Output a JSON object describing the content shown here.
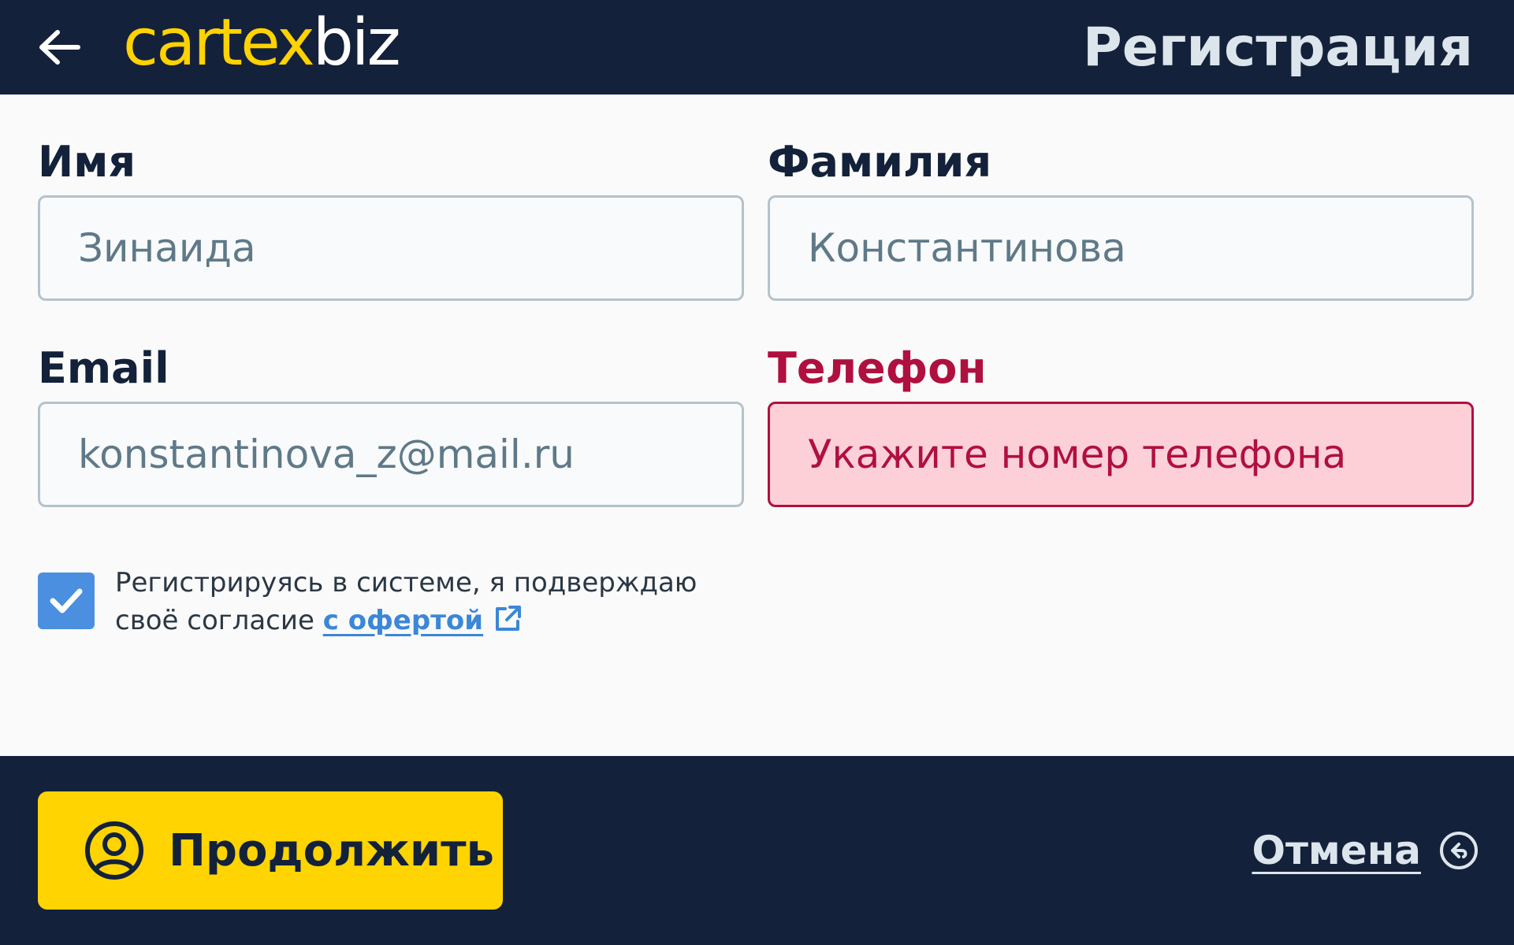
{
  "header": {
    "logo_part1": "cartex",
    "logo_part2": "biz",
    "title": "Регистрация",
    "back_icon": "arrow-left-icon"
  },
  "form": {
    "first_name": {
      "label": "Имя",
      "value": "Зинаида"
    },
    "last_name": {
      "label": "Фамилия",
      "value": "Константинова"
    },
    "email": {
      "label": "Email",
      "value": "konstantinova_z@mail.ru"
    },
    "phone": {
      "label": "Телефон",
      "value": "",
      "placeholder": "Укажите номер телефона",
      "state": "error"
    }
  },
  "consent": {
    "checked": true,
    "text_line1": "Регистрируясь в системе, я подверждаю",
    "text_line2": "своё согласие",
    "link_text": "с офертой"
  },
  "footer": {
    "continue_label": "Продолжить",
    "cancel_label": "Отмена"
  },
  "colors": {
    "header_bg": "#14213a",
    "brand_yellow": "#ffd400",
    "error_red": "#b0103f",
    "error_bg": "#fdd0d8",
    "link_blue": "#3b87d8",
    "checkbox_blue": "#4a8fe0"
  }
}
